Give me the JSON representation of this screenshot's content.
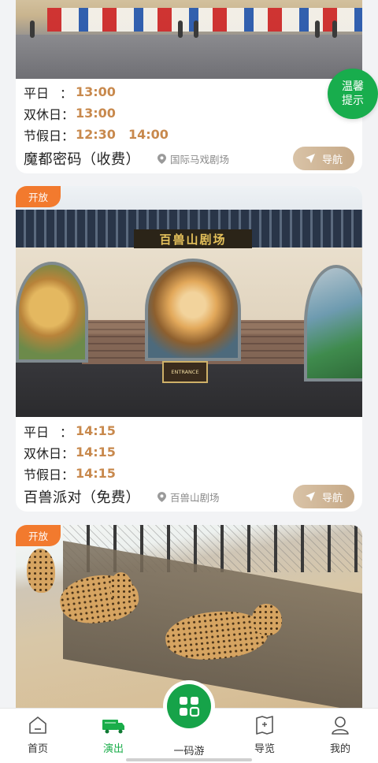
{
  "floating_tip": {
    "label_line1": "温馨",
    "label_line2": "提示"
  },
  "shows": [
    {
      "badge": "",
      "schedule": [
        {
          "label": "平日",
          "colon": "：",
          "times": [
            "13:00"
          ]
        },
        {
          "label": "双休日",
          "colon": "：",
          "times": [
            "13:00"
          ]
        },
        {
          "label": "节假日",
          "colon": "：",
          "times": [
            "12:30",
            "14:00"
          ]
        }
      ],
      "title": "魔都密码（收费）",
      "venue": "国际马戏剧场",
      "nav_label": "导航"
    },
    {
      "badge": "开放",
      "sign_text": "百兽山剧场",
      "entrance_text": "ENTRANCE",
      "schedule": [
        {
          "label": "平日",
          "colon": "：",
          "times": [
            "14:15"
          ]
        },
        {
          "label": "双休日",
          "colon": "：",
          "times": [
            "14:15"
          ]
        },
        {
          "label": "节假日",
          "colon": "：",
          "times": [
            "14:15"
          ]
        }
      ],
      "title": "百兽派对（免费）",
      "venue": "百兽山剧场",
      "nav_label": "导航"
    },
    {
      "badge": "开放"
    }
  ],
  "tabbar": {
    "items": [
      {
        "label": "首页",
        "icon": "home-icon"
      },
      {
        "label": "演出",
        "icon": "show-truck-icon"
      },
      {
        "label": "一码游",
        "icon": "apps-grid-icon"
      },
      {
        "label": "导览",
        "icon": "map-guide-icon"
      },
      {
        "label": "我的",
        "icon": "user-icon"
      }
    ],
    "active_index": 1
  },
  "colors": {
    "accent_green": "#18ad4d",
    "time_orange": "#c8894d",
    "badge_orange": "#f27a2e",
    "nav_button": "#c6a987"
  }
}
